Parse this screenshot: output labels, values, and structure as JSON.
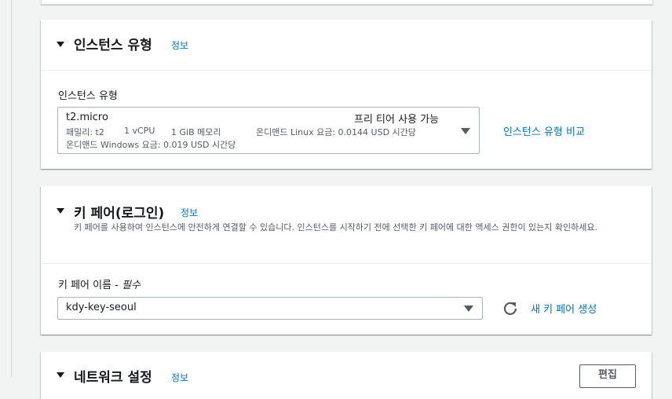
{
  "instance_type": {
    "title": "인스턴스 유형",
    "info": "정보",
    "field_label": "인스턴스 유형",
    "selected": "t2.micro",
    "free_tier": "프리 티어 사용 가능",
    "family": "패밀리: t2",
    "vcpu": "1 vCPU",
    "memory": "1 GiB 메모리",
    "linux_price": "온디맨드 Linux 요금: 0.0144 USD 시간당",
    "windows_price": "온디맨드 Windows 요금: 0.019 USD 시간당",
    "compare_link": "인스턴스 유형 비교"
  },
  "key_pair": {
    "title": "키 페어(로그인)",
    "info": "정보",
    "description": "키 페어를 사용하여 인스턴스에 안전하게 연결할 수 있습니다. 인스턴스를 시작하기 전에 선택한 키 페어에 대한 액세스 권한이 있는지 확인하세요.",
    "field_label": "키 페어 이름 - ",
    "field_required": "필수",
    "selected": "kdy-key-seoul",
    "create_link": "새 키 페어 생성"
  },
  "network": {
    "title": "네트워크 설정",
    "info": "정보",
    "edit_label": "편집"
  }
}
